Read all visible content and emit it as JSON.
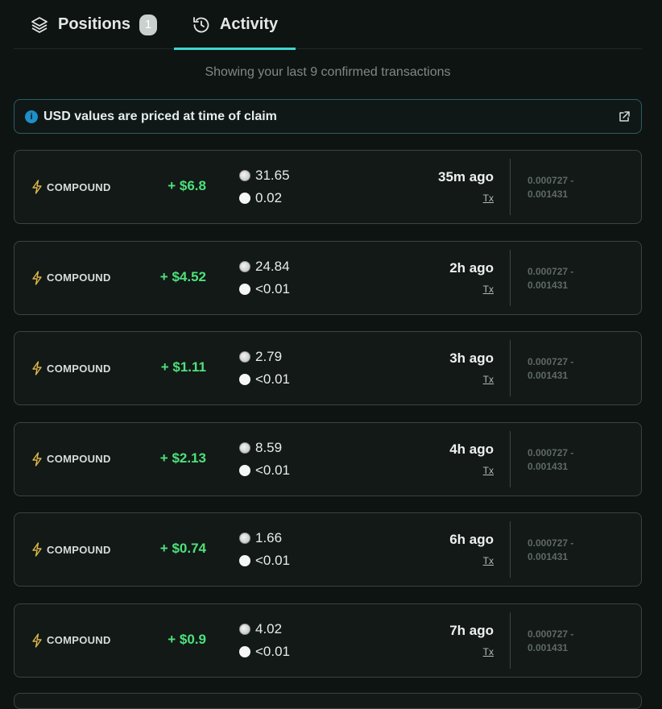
{
  "tabs": [
    {
      "label": "Positions",
      "badge": "1",
      "icon": "layers-icon"
    },
    {
      "label": "Activity",
      "icon": "history-icon",
      "active": true
    }
  ],
  "subtitle": "Showing your last 9 confirmed transactions",
  "notice": {
    "text": "USD values are priced at time of claim",
    "info_glyph": "i",
    "icon": "external-link-icon"
  },
  "colors": {
    "accent": "#3fd5cf",
    "positive": "#4ee17b",
    "info": "#1e8fc9"
  },
  "transactions": [
    {
      "type": "COMPOUND",
      "usd": "+ $6.8",
      "token_a": "31.65",
      "token_b": "0.02",
      "time": "35m ago",
      "tx": "Tx",
      "range_low": "0.000727 -",
      "range_high": "0.001431"
    },
    {
      "type": "COMPOUND",
      "usd": "+ $4.52",
      "token_a": "24.84",
      "token_b": "<0.01",
      "time": "2h ago",
      "tx": "Tx",
      "range_low": "0.000727 -",
      "range_high": "0.001431"
    },
    {
      "type": "COMPOUND",
      "usd": "+ $1.11",
      "token_a": "2.79",
      "token_b": "<0.01",
      "time": "3h ago",
      "tx": "Tx",
      "range_low": "0.000727 -",
      "range_high": "0.001431"
    },
    {
      "type": "COMPOUND",
      "usd": "+ $2.13",
      "token_a": "8.59",
      "token_b": "<0.01",
      "time": "4h ago",
      "tx": "Tx",
      "range_low": "0.000727 -",
      "range_high": "0.001431"
    },
    {
      "type": "COMPOUND",
      "usd": "+ $0.74",
      "token_a": "1.66",
      "token_b": "<0.01",
      "time": "6h ago",
      "tx": "Tx",
      "range_low": "0.000727 -",
      "range_high": "0.001431"
    },
    {
      "type": "COMPOUND",
      "usd": "+ $0.9",
      "token_a": "4.02",
      "token_b": "<0.01",
      "time": "7h ago",
      "tx": "Tx",
      "range_low": "0.000727 -",
      "range_high": "0.001431"
    }
  ]
}
